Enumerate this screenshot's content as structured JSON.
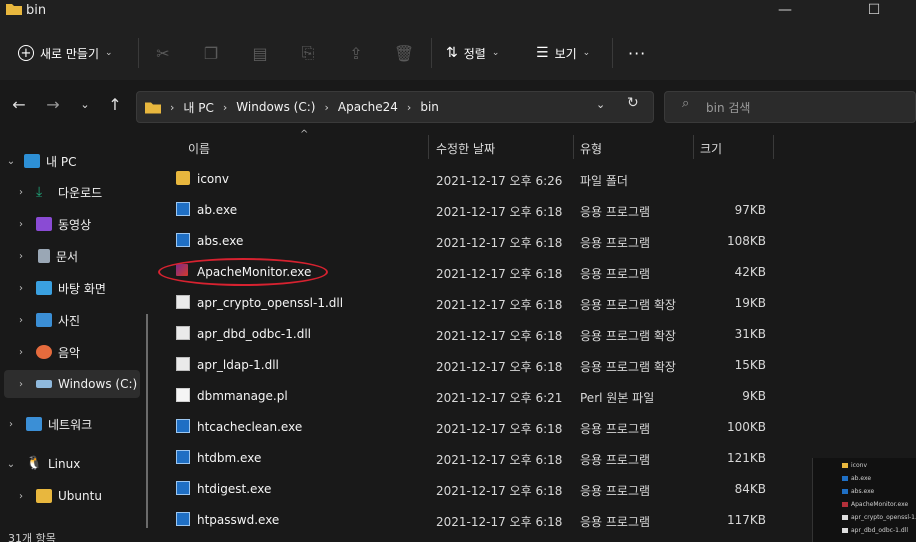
{
  "window": {
    "title": "bin",
    "min": "—",
    "max": "☐"
  },
  "toolbar": {
    "new_label": "새로 만들기",
    "sort_label": "정렬",
    "view_label": "보기",
    "more_label": "···"
  },
  "address": {
    "crumbs": [
      "내 PC",
      "Windows (C:)",
      "Apache24",
      "bin"
    ],
    "search_placeholder": "bin 검색"
  },
  "sidebar": {
    "items": [
      {
        "label": "내 PC",
        "color": "#2d8fd5"
      },
      {
        "label": "다운로드",
        "color": "#1fa67a"
      },
      {
        "label": "동영상",
        "color": "#8a4bd4"
      },
      {
        "label": "문서",
        "color": "#9aa7b5"
      },
      {
        "label": "바탕 화면",
        "color": "#3aa0e0"
      },
      {
        "label": "사진",
        "color": "#3b8fd6"
      },
      {
        "label": "음악",
        "color": "#e56b3d"
      },
      {
        "label": "Windows (C:)",
        "color": "#8fb9dd"
      },
      {
        "label": "네트워크",
        "color": "#3b8fd6"
      },
      {
        "label": "Linux",
        "color": "#f0f0f0"
      },
      {
        "label": "Ubuntu",
        "color": "#e8b73e"
      }
    ]
  },
  "columns": {
    "name": "이름",
    "date": "수정한 날짜",
    "type": "유형",
    "size": "크기"
  },
  "files": [
    {
      "name": "iconv",
      "date": "2021-12-17 오후 6:26",
      "type": "파일 폴더",
      "size": "",
      "icon": "folder"
    },
    {
      "name": "ab.exe",
      "date": "2021-12-17 오후 6:18",
      "type": "응용 프로그램",
      "size": "97KB",
      "icon": "exe"
    },
    {
      "name": "abs.exe",
      "date": "2021-12-17 오후 6:18",
      "type": "응용 프로그램",
      "size": "108KB",
      "icon": "exe"
    },
    {
      "name": "ApacheMonitor.exe",
      "date": "2021-12-17 오후 6:18",
      "type": "응용 프로그램",
      "size": "42KB",
      "icon": "feather"
    },
    {
      "name": "apr_crypto_openssl-1.dll",
      "date": "2021-12-17 오후 6:18",
      "type": "응용 프로그램 확장",
      "size": "19KB",
      "icon": "dll"
    },
    {
      "name": "apr_dbd_odbc-1.dll",
      "date": "2021-12-17 오후 6:18",
      "type": "응용 프로그램 확장",
      "size": "31KB",
      "icon": "dll"
    },
    {
      "name": "apr_ldap-1.dll",
      "date": "2021-12-17 오후 6:18",
      "type": "응용 프로그램 확장",
      "size": "15KB",
      "icon": "dll"
    },
    {
      "name": "dbmmanage.pl",
      "date": "2021-12-17 오후 6:21",
      "type": "Perl 원본 파일",
      "size": "9KB",
      "icon": "pl"
    },
    {
      "name": "htcacheclean.exe",
      "date": "2021-12-17 오후 6:18",
      "type": "응용 프로그램",
      "size": "100KB",
      "icon": "exe"
    },
    {
      "name": "htdbm.exe",
      "date": "2021-12-17 오후 6:18",
      "type": "응용 프로그램",
      "size": "121KB",
      "icon": "exe"
    },
    {
      "name": "htdigest.exe",
      "date": "2021-12-17 오후 6:18",
      "type": "응용 프로그램",
      "size": "84KB",
      "icon": "exe"
    },
    {
      "name": "htpasswd.exe",
      "date": "2021-12-17 오후 6:18",
      "type": "응용 프로그램",
      "size": "117KB",
      "icon": "exe"
    }
  ],
  "status": {
    "count": "31개 항목"
  },
  "preview": {
    "items": [
      "iconv",
      "ab.exe",
      "abs.exe",
      "ApacheMonitor.exe",
      "apr_crypto_openssl-1.dll",
      "apr_dbd_odbc-1.dll"
    ]
  }
}
